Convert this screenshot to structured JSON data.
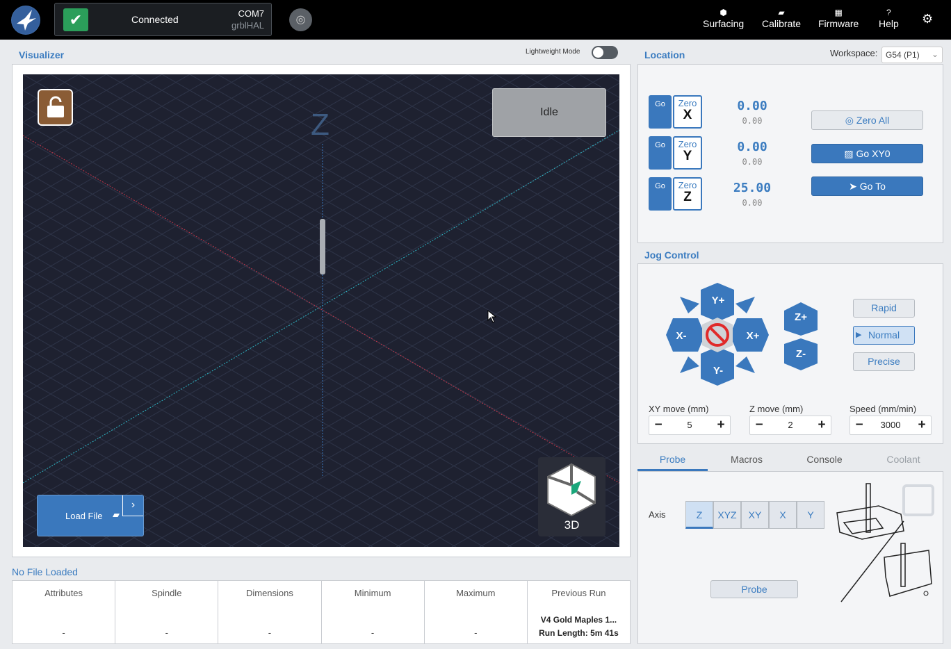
{
  "header": {
    "status": "Connected",
    "port": "COM7",
    "firmware": "grblHAL",
    "nav": [
      {
        "label": "Surfacing",
        "icon": "surfacing-icon"
      },
      {
        "label": "Calibrate",
        "icon": "ruler-icon"
      },
      {
        "label": "Firmware",
        "icon": "chip-icon"
      },
      {
        "label": "Help",
        "icon": "question-icon"
      }
    ]
  },
  "visualizer": {
    "title": "Visualizer",
    "lightweight_label": "Lightweight Mode",
    "lightweight_on": false,
    "state": "Idle",
    "z_axis_label": "Z",
    "cube_label": "3D",
    "load_file_label": "Load File"
  },
  "file": {
    "status": "No File Loaded",
    "columns": [
      "Attributes",
      "Spindle",
      "Dimensions",
      "Minimum",
      "Maximum",
      "Previous Run"
    ],
    "values": [
      "-",
      "-",
      "-",
      "-",
      "-"
    ],
    "previous_run_name": "V4 Gold Maples 1...",
    "previous_run_length": "Run Length: 5m 41s"
  },
  "location": {
    "title": "Location",
    "workspace_label": "Workspace:",
    "workspace_value": "G54 (P1)",
    "go_label": "Go",
    "zero_label": "Zero",
    "axes": [
      {
        "axis": "X",
        "work": "0.00",
        "machine": "0.00"
      },
      {
        "axis": "Y",
        "work": "0.00",
        "machine": "0.00"
      },
      {
        "axis": "Z",
        "work": "25.00",
        "machine": "0.00"
      }
    ],
    "buttons": {
      "zero_all": "Zero All",
      "go_xy0": "Go XY0",
      "go_to": "Go To"
    }
  },
  "jog": {
    "title": "Jog Control",
    "labels": {
      "yplus": "Y+",
      "yminus": "Y-",
      "xplus": "X+",
      "xminus": "X-",
      "zplus": "Z+",
      "zminus": "Z-"
    },
    "speeds": [
      "Rapid",
      "Normal",
      "Precise"
    ],
    "active_speed": "Normal",
    "xy_label": "XY move (mm)",
    "z_label": "Z move (mm)",
    "speed_label": "Speed (mm/min)",
    "xy_value": "5",
    "z_value": "2",
    "speed_value": "3000",
    "colors": {
      "accent": "#3a78bd",
      "stop": "#e02a2a"
    }
  },
  "tools": {
    "tabs": [
      "Probe",
      "Macros",
      "Console",
      "Coolant"
    ],
    "active_tab": "Probe",
    "axis_label": "Axis",
    "axis_options": [
      "Z",
      "XYZ",
      "XY",
      "X",
      "Y"
    ],
    "active_axis": "Z",
    "probe_button": "Probe"
  }
}
